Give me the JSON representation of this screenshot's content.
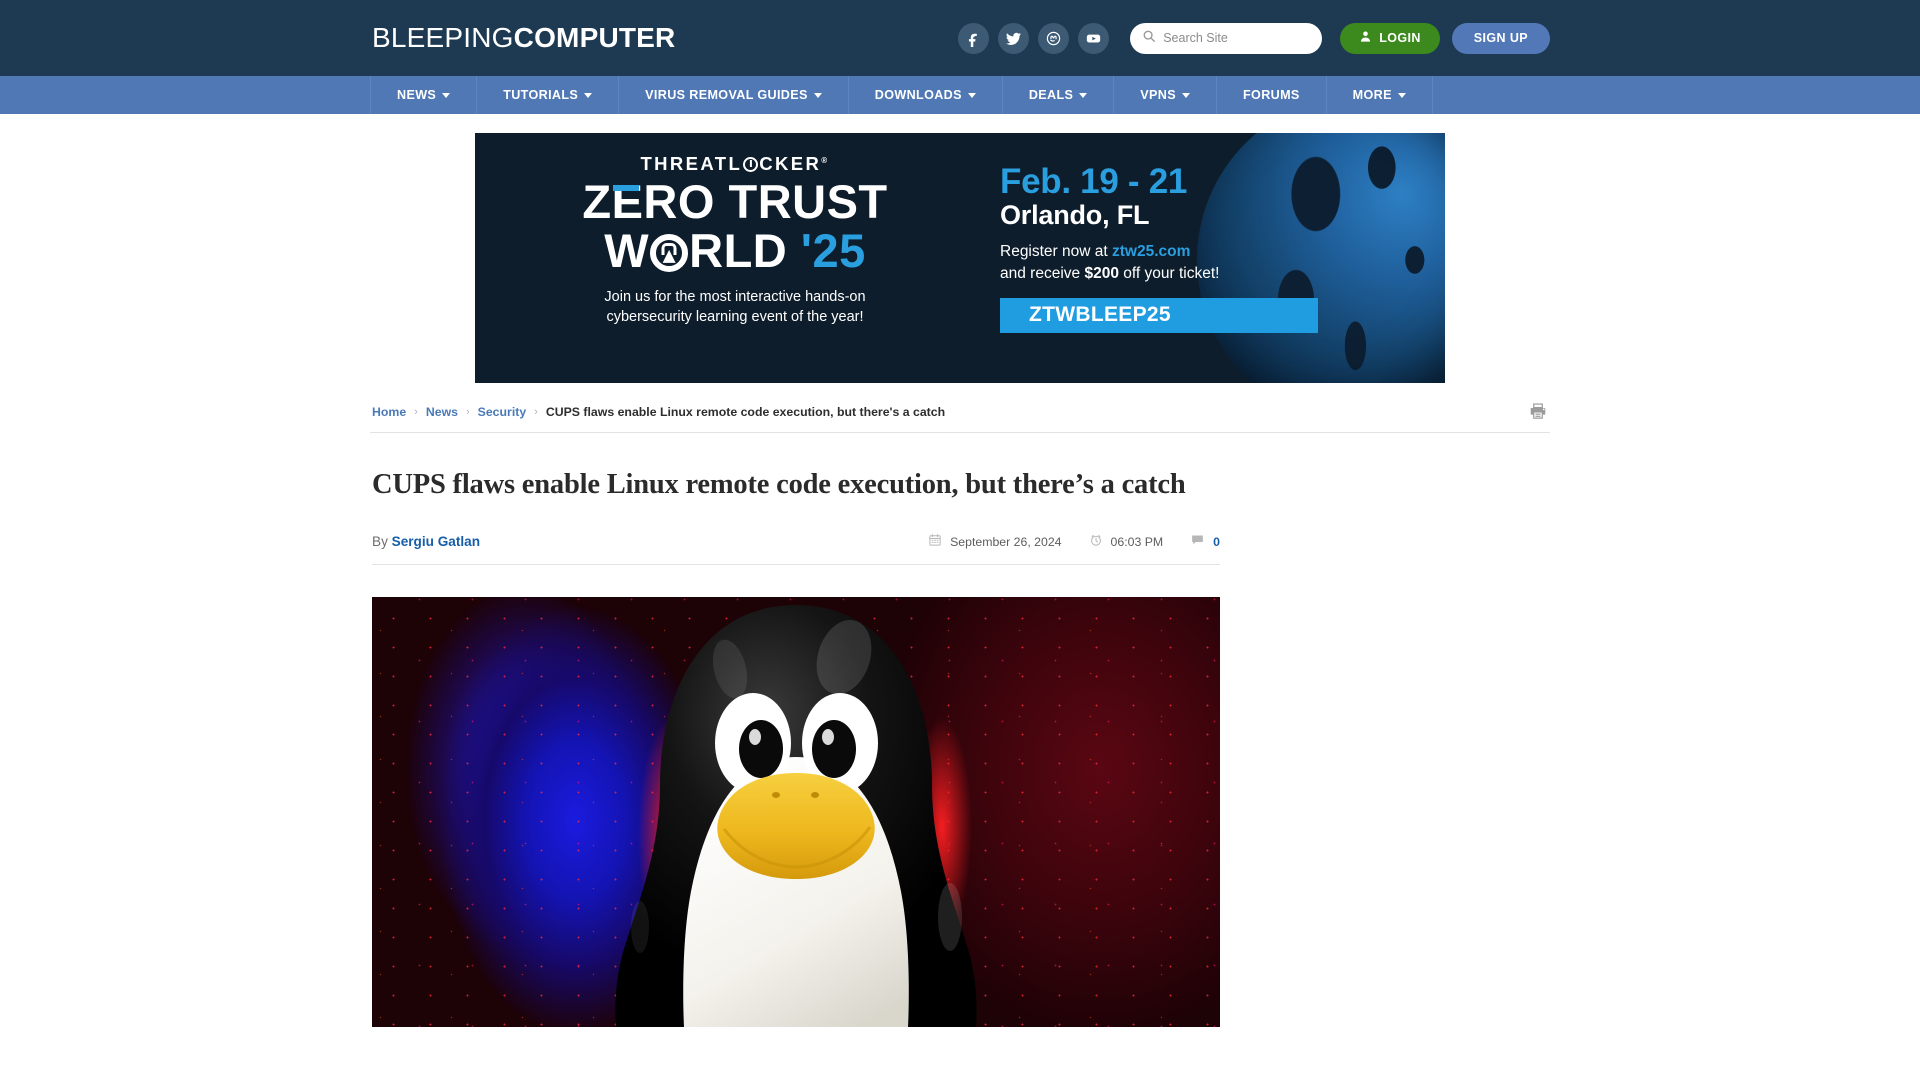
{
  "site": {
    "logo_light": "BLEEPING",
    "logo_bold": "COMPUTER"
  },
  "header": {
    "social": [
      {
        "name": "facebook-icon",
        "label": "Facebook"
      },
      {
        "name": "twitter-icon",
        "label": "Twitter"
      },
      {
        "name": "mastodon-icon",
        "label": "Mastodon"
      },
      {
        "name": "youtube-icon",
        "label": "YouTube"
      }
    ],
    "search": {
      "placeholder": "Search Site",
      "value": "",
      "icon": "search-icon"
    },
    "login_label": "LOGIN",
    "signup_label": "SIGN UP",
    "login_color": "#3c8a1e",
    "signup_color": "#5278b7",
    "bg_color": "#1e3a52"
  },
  "nav": {
    "bg_color": "#4f78b5",
    "items": [
      {
        "label": "NEWS",
        "has_dropdown": true
      },
      {
        "label": "TUTORIALS",
        "has_dropdown": true
      },
      {
        "label": "VIRUS REMOVAL GUIDES",
        "has_dropdown": true
      },
      {
        "label": "DOWNLOADS",
        "has_dropdown": true
      },
      {
        "label": "DEALS",
        "has_dropdown": true
      },
      {
        "label": "VPNS",
        "has_dropdown": true
      },
      {
        "label": "FORUMS",
        "has_dropdown": false
      },
      {
        "label": "MORE",
        "has_dropdown": true
      }
    ]
  },
  "ad": {
    "brand": "THREATL",
    "brand_tail": "CKER",
    "brand_reg": "®",
    "headline_line1_a": "Z",
    "headline_line1_e": "E",
    "headline_line1_b": "RO TRUST",
    "headline_line2_a": "W",
    "headline_line2_b": "RLD",
    "headline_year": "'25",
    "sub_line1": "Join us for the most interactive hands-on",
    "sub_line2": "cybersecurity learning event of the year!",
    "dates": "Feb. 19 - 21",
    "city": "Orlando, FL",
    "register_prefix": "Register now at ",
    "register_site": "ztw25.com",
    "offer_prefix": "and receive ",
    "offer_amount": "$200",
    "offer_suffix": " off your ticket!",
    "promo_code": "ZTWBLEEP25",
    "accent_color": "#2a9fe0",
    "bg_color": "#0e1d2b"
  },
  "breadcrumb": {
    "items": [
      {
        "label": "Home",
        "is_link": true
      },
      {
        "label": "News",
        "is_link": true
      },
      {
        "label": "Security",
        "is_link": true
      },
      {
        "label": "CUPS flaws enable Linux remote code execution, but there's a catch",
        "is_link": false
      }
    ],
    "separator": "›",
    "print_icon": "printer-icon"
  },
  "article": {
    "title": "CUPS flaws enable Linux remote code execution, but there’s a catch",
    "by_prefix": "By ",
    "author": "Sergiu Gatlan",
    "date": "September 26, 2024",
    "date_icon": "calendar-icon",
    "time": "06:03 PM",
    "time_icon": "clock-icon",
    "comment_count": "0",
    "comment_icon": "comment-icon",
    "hero_alt": "Tux the Linux penguin on red and blue abstract background"
  }
}
